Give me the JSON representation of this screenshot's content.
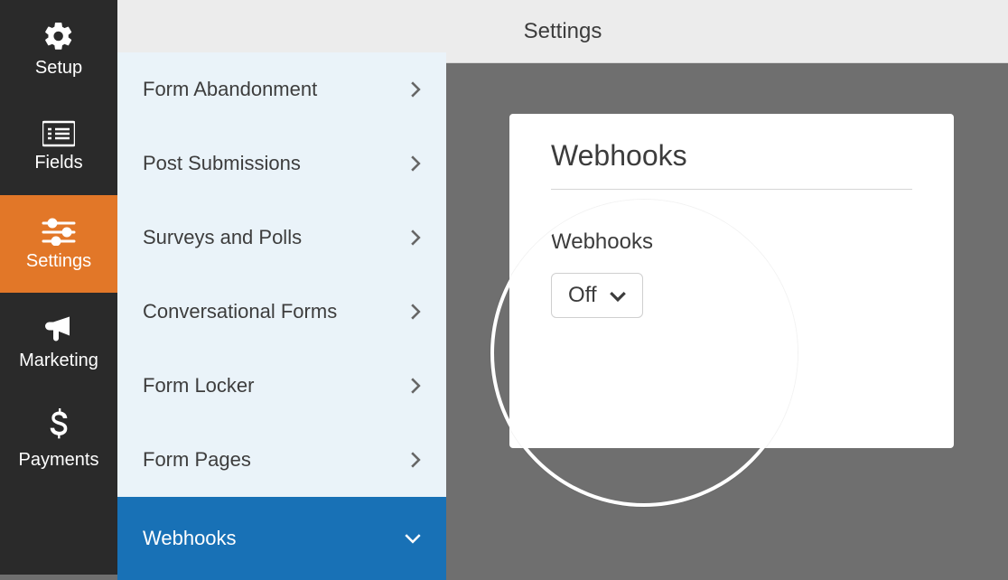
{
  "nav": [
    {
      "key": "setup",
      "label": "Setup",
      "icon": "gear"
    },
    {
      "key": "fields",
      "label": "Fields",
      "icon": "list"
    },
    {
      "key": "settings",
      "label": "Settings",
      "icon": "sliders"
    },
    {
      "key": "marketing",
      "label": "Marketing",
      "icon": "bullhorn"
    },
    {
      "key": "payments",
      "label": "Payments",
      "icon": "dollar"
    }
  ],
  "nav_active": "settings",
  "topbar": {
    "title": "Settings"
  },
  "settings_items": [
    {
      "label": "Form Abandonment"
    },
    {
      "label": "Post Submissions"
    },
    {
      "label": "Surveys and Polls"
    },
    {
      "label": "Conversational Forms"
    },
    {
      "label": "Form Locker"
    },
    {
      "label": "Form Pages"
    },
    {
      "label": "Webhooks",
      "active": true
    }
  ],
  "card": {
    "title": "Webhooks",
    "field_label": "Webhooks",
    "dropdown_value": "Off"
  }
}
